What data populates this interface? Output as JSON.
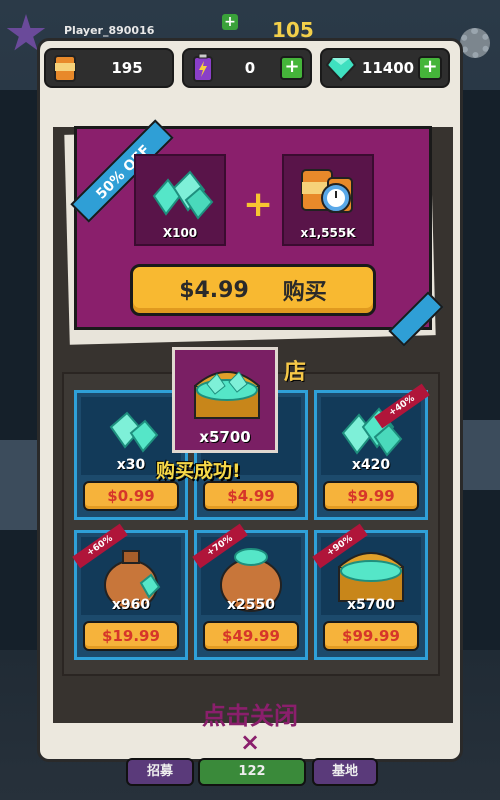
{
  "hud": {
    "player_label": "Player_890016",
    "score": "105"
  },
  "currency": {
    "coins": "195",
    "energy": "0",
    "gems": "11400"
  },
  "offer": {
    "badge": "50% OFF",
    "item1_qty": "X100",
    "item2_qty": "x1,555K",
    "plus": "+",
    "price": "$4.99",
    "buy_label": "购买"
  },
  "store": {
    "title": "店",
    "cards": [
      {
        "qty": "x30",
        "price": "$0.99",
        "ribbon": ""
      },
      {
        "qty": "",
        "price": "$4.99",
        "ribbon": ""
      },
      {
        "qty": "x420",
        "price": "$9.99",
        "ribbon": "+40%"
      },
      {
        "qty": "x960",
        "price": "$19.99",
        "ribbon": "+60%"
      },
      {
        "qty": "x2550",
        "price": "$49.99",
        "ribbon": "+70%"
      },
      {
        "qty": "x5700",
        "price": "$99.99",
        "ribbon": "+90%"
      }
    ]
  },
  "popup": {
    "qty": "x5700",
    "success_text": "购买成功!"
  },
  "footer": {
    "close_text": "点击关闭",
    "close_x": "×"
  },
  "bottom_bar": {
    "left": "招募",
    "center": "122",
    "right": "基地"
  },
  "colors": {
    "accent_purple": "#8a1f6c",
    "card_blue": "#2fa0d8",
    "price_orange": "#f6b33b",
    "plus_green": "#45b53a"
  }
}
